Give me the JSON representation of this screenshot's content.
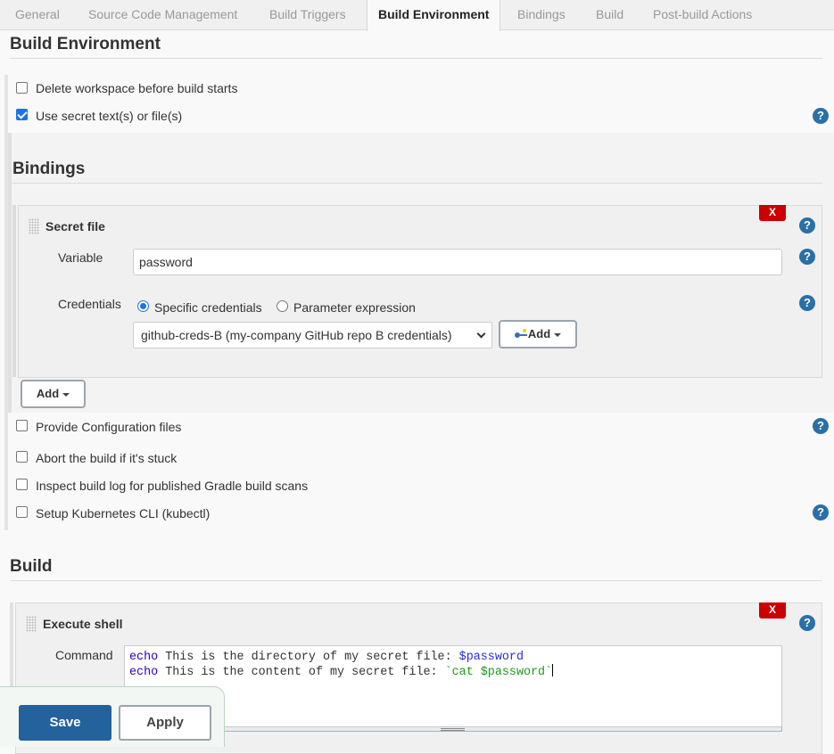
{
  "tabs": [
    {
      "label": "General",
      "active": false
    },
    {
      "label": "Source Code Management",
      "active": false
    },
    {
      "label": "Build Triggers",
      "active": false
    },
    {
      "label": "Build Environment",
      "active": true
    },
    {
      "label": "Bindings",
      "active": false
    },
    {
      "label": "Build",
      "active": false
    },
    {
      "label": "Post-build Actions",
      "active": false
    }
  ],
  "build_environment": {
    "title": "Build Environment",
    "options": [
      {
        "label": "Delete workspace before build starts",
        "checked": false
      },
      {
        "label": "Use secret text(s) or file(s)",
        "checked": true
      }
    ],
    "bindings": {
      "title": "Bindings",
      "secret_file": {
        "title": "Secret file",
        "delete_label": "X",
        "variable_label": "Variable",
        "variable_value": "password",
        "credentials_label": "Credentials",
        "radio_options": [
          {
            "label": "Specific credentials",
            "checked": true
          },
          {
            "label": "Parameter expression",
            "checked": false
          }
        ],
        "credentials_selected": "github-creds-B (my-company GitHub repo B credentials)",
        "add_credentials_label": "Add"
      },
      "add_binding_label": "Add"
    },
    "more_options": [
      {
        "label": "Provide Configuration files",
        "checked": false
      },
      {
        "label": "Abort the build if it's stuck",
        "checked": false
      },
      {
        "label": "Inspect build log for published Gradle build scans",
        "checked": false
      },
      {
        "label": "Setup Kubernetes CLI (kubectl)",
        "checked": false
      }
    ]
  },
  "build": {
    "title": "Build",
    "execute_shell": {
      "title": "Execute shell",
      "delete_label": "X",
      "command_label": "Command",
      "command_lines": [
        {
          "kw": "echo",
          "text": " This is the directory of my secret file: ",
          "var": "$password",
          "str": ""
        },
        {
          "kw": "echo",
          "text": " This is the content of my secret file: ",
          "var": "",
          "str": "`cat $password`"
        }
      ]
    }
  },
  "footer": {
    "save_label": "Save",
    "apply_label": "Apply"
  },
  "icons": {
    "help": "?",
    "credentials_add": "key-icon"
  },
  "colors": {
    "save_bg": "#23629c",
    "delete_bg": "#cc0000",
    "help_bg": "#2a6fa8",
    "checkbox_checked": "#1a73e8"
  }
}
